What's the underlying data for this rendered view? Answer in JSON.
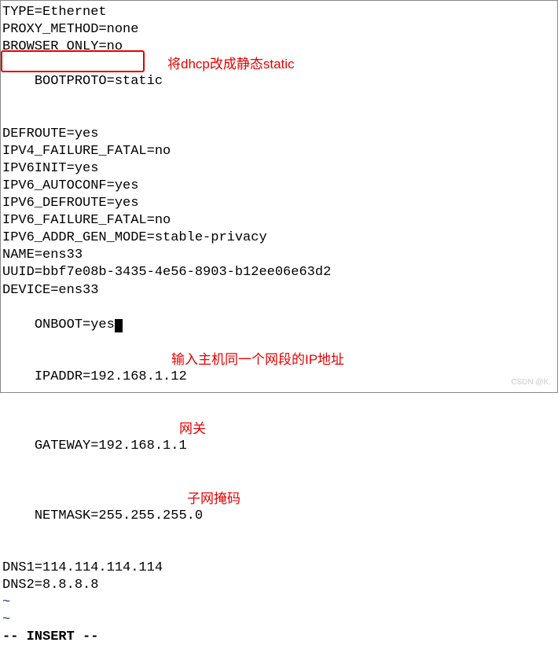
{
  "config": {
    "lines": [
      "TYPE=Ethernet",
      "PROXY_METHOD=none",
      "BROWSER_ONLY=no",
      "BOOTPROTO=static",
      "DEFROUTE=yes",
      "IPV4_FAILURE_FATAL=no",
      "IPV6INIT=yes",
      "IPV6_AUTOCONF=yes",
      "IPV6_DEFROUTE=yes",
      "IPV6_FAILURE_FATAL=no",
      "IPV6_ADDR_GEN_MODE=stable-privacy",
      "NAME=ens33",
      "UUID=bbf7e08b-3435-4e56-8903-b12ee06e63d2",
      "DEVICE=ens33",
      "ONBOOT=yes",
      "",
      "IPADDR=192.168.1.12",
      "GATEWAY=192.168.1.1",
      "NETMASK=255.255.255.0",
      "DNS1=114.114.114.114",
      "DNS2=8.8.8.8"
    ]
  },
  "annotations": {
    "bootproto": "将dhcp改成静态static",
    "ipaddr": "输入主机同一个网段的IP地址",
    "gateway": "网关",
    "netmask": "子网掩码"
  },
  "tilde": "~",
  "status": "-- INSERT --",
  "watermark": "CSDN @K."
}
